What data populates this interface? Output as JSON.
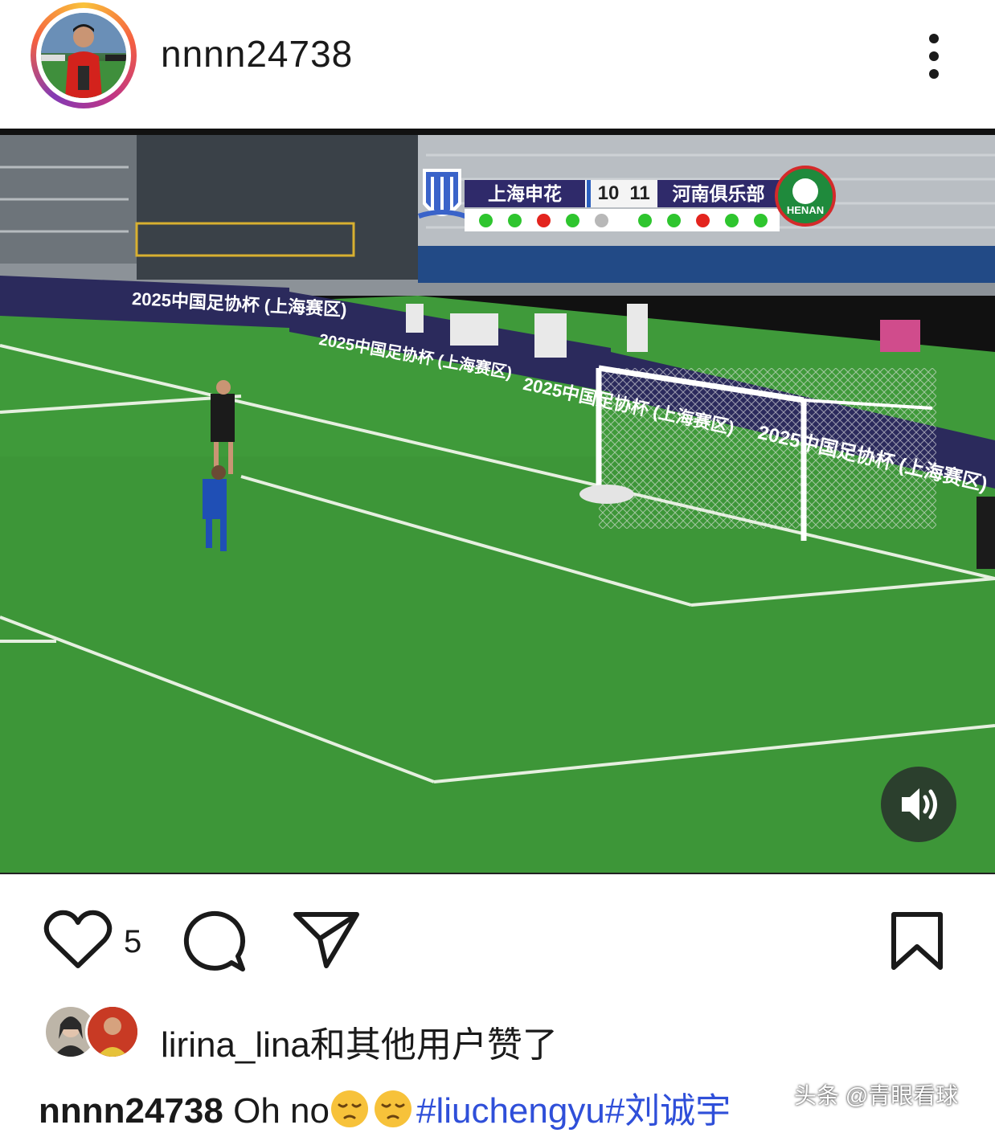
{
  "header": {
    "username": "nnnn24738"
  },
  "video": {
    "scoreboard": {
      "home_team": "上海申花",
      "away_team": "河南俱乐部",
      "home_score": "10",
      "away_score": "11",
      "away_badge_text": "HENAN",
      "home_kicks": [
        "scored",
        "scored",
        "missed",
        "scored",
        "pending"
      ],
      "away_kicks": [
        "scored",
        "scored",
        "missed",
        "scored",
        "scored"
      ],
      "colors": {
        "scored": "#2ec52e",
        "missed": "#e3241e",
        "pending": "#b8b8b8"
      }
    },
    "ad_boards": [
      "2025中国足协杯 (上海赛区)",
      "2025中国足协杯 (上海赛区)",
      "2025中国足协杯 (上海赛区)",
      "2025中国足协杯 (上海赛区)"
    ],
    "sound_icon": "speaker-icon"
  },
  "actions": {
    "like_count": "5"
  },
  "liked_by": {
    "text": "lirina_lina和其他用户赞了"
  },
  "caption": {
    "username": "nnnn24738",
    "text": " Oh no",
    "tags": "#liuchengyu#刘诚宇"
  },
  "watermark": "头条 @青眼看球"
}
